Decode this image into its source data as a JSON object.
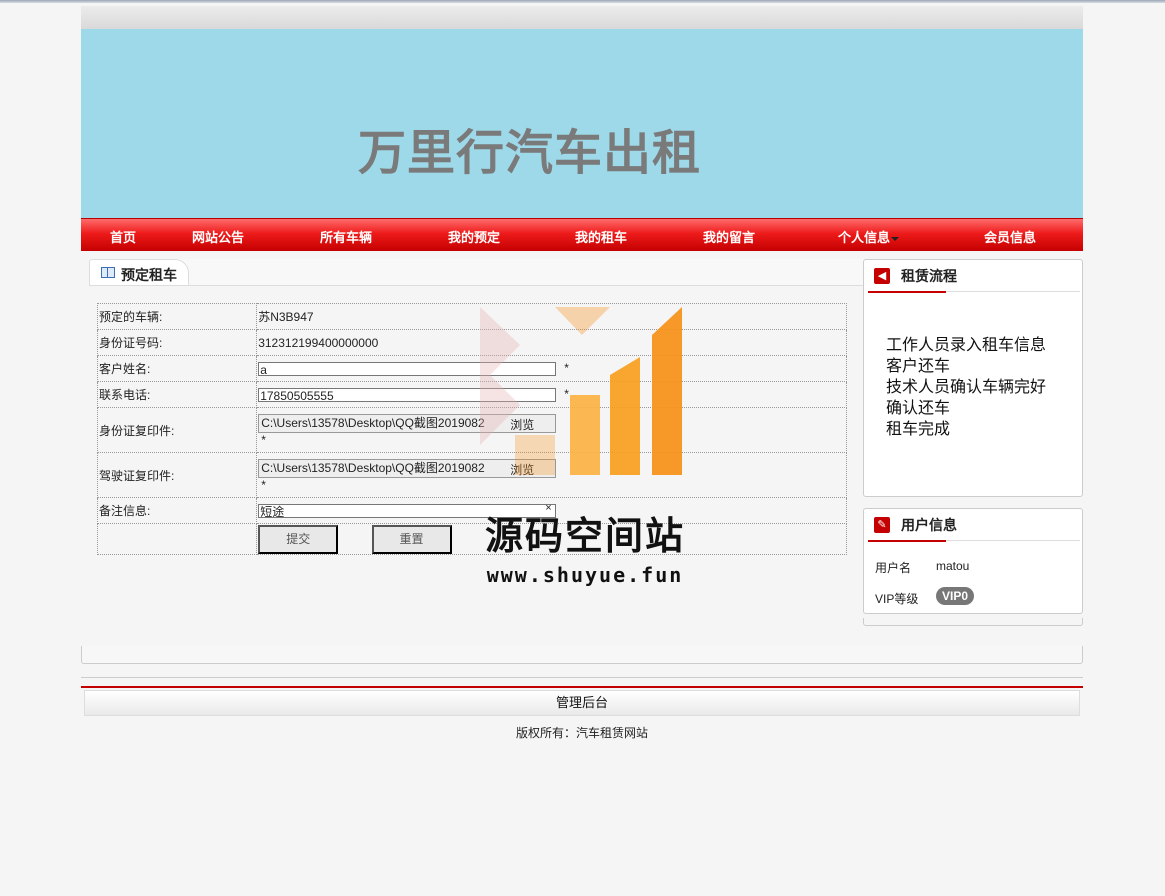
{
  "site": {
    "banner_title": "万里行汽车出租"
  },
  "nav": {
    "items": [
      "首页",
      "网站公告",
      "所有车辆",
      "我的预定",
      "我的租车",
      "我的留言",
      "个人信息",
      "会员信息"
    ]
  },
  "booking": {
    "tab_label": "预定租车",
    "rows": {
      "car": {
        "label": "预定的车辆:",
        "value": "苏N3B947"
      },
      "idno": {
        "label": "身份证号码:",
        "value": "312312199400000000"
      },
      "name": {
        "label": "客户姓名:",
        "value": "a",
        "required": "*"
      },
      "phone": {
        "label": "联系电话:",
        "value": "17850505555",
        "required": "*"
      },
      "idcopy": {
        "label": "身份证复印件:",
        "value": "C:\\Users\\13578\\Desktop\\QQ截图2019082",
        "tail": "浏览",
        "required": "*"
      },
      "license": {
        "label": "驾驶证复印件:",
        "value": "C:\\Users\\13578\\Desktop\\QQ截图2019082",
        "tail": "浏览",
        "required": "*"
      },
      "note": {
        "label": "备注信息:",
        "value": "短途",
        "clear": "×"
      }
    },
    "submit_label": "提交",
    "reset_label": "重置"
  },
  "flow_panel": {
    "title": "租赁流程",
    "steps": [
      "工作人员录入租车信息",
      "客户还车",
      "技术人员确认车辆完好",
      "确认还车",
      "租车完成"
    ]
  },
  "user_panel": {
    "title": "用户信息",
    "username_label": "用户名",
    "username": "matou",
    "vip_label": "VIP等级",
    "vip_value": "VIP0"
  },
  "footer": {
    "admin_label": "管理后台",
    "copyright": "版权所有：汽车租赁网站"
  },
  "watermark": {
    "text": "源码空间站",
    "url": "www.shuyue.fun"
  },
  "colors": {
    "nav_red": "#ee1b1b",
    "banner": "#9ed9ea",
    "accent": "#c40000",
    "wm_orange": "#f7931e"
  }
}
